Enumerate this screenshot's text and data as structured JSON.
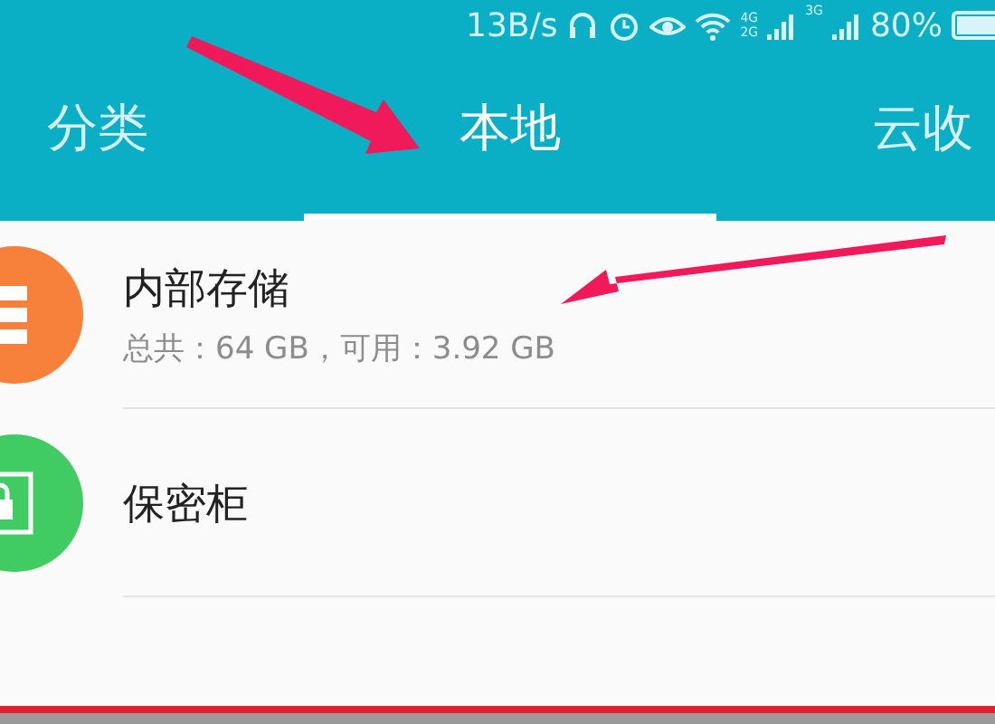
{
  "status_bar": {
    "speed": "13B/s",
    "network_labels": [
      "4G",
      "2G",
      "3G"
    ],
    "battery": "80%"
  },
  "tabs": [
    {
      "label": "分类",
      "selected": false
    },
    {
      "label": "本地",
      "selected": true
    },
    {
      "label": "云收",
      "selected": false
    }
  ],
  "storage_items": [
    {
      "kind": "internal",
      "title": "内部存储",
      "detail": "总共：64 GB，可用：3.92 GB"
    },
    {
      "kind": "safe",
      "title": "保密柜"
    }
  ]
}
